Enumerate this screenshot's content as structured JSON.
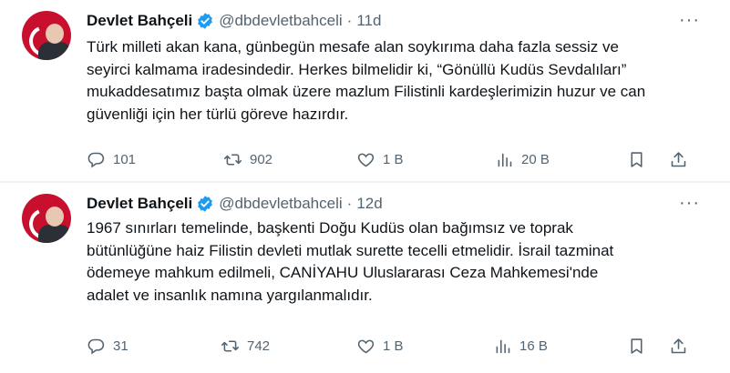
{
  "tweets": [
    {
      "author": "Devlet Bahçeli",
      "handle": "@dbdevletbahceli",
      "separator": "·",
      "time": "11d",
      "more": "···",
      "text": "Türk milleti akan kana, günbegün mesafe alan soykırıma daha fazla sessiz ve seyirci kalmama iradesindedir. Herkes bilmelidir ki, “Gönüllü Kudüs Sevdalıları” mukaddesatımız başta olmak üzere mazlum Filistinli kardeşlerimizin huzur ve can güvenliği için her türlü göreve hazırdır.",
      "stats": {
        "replies": "101",
        "reposts": "902",
        "likes": "1 B",
        "views": "20 B"
      }
    },
    {
      "author": "Devlet Bahçeli",
      "handle": "@dbdevletbahceli",
      "separator": "·",
      "time": "12d",
      "more": "···",
      "text": "1967 sınırları temelinde, başkenti Doğu Kudüs olan bağımsız ve toprak bütünlüğüne haiz Filistin devleti mutlak surette tecelli etmelidir. İsrail tazminat ödemeye mahkum edilmeli, CANİYAHU Uluslararası Ceza Mahkemesi'nde adalet ve insanlık namına yargılanmalıdır.",
      "stats": {
        "replies": "31",
        "reposts": "742",
        "likes": "1 B",
        "views": "16 B"
      }
    }
  ],
  "icons": {
    "reply": "reply-icon",
    "repost": "repost-icon",
    "like": "like-icon",
    "views": "views-icon",
    "bookmark": "bookmark-icon",
    "share": "share-icon",
    "verified": "verified-badge-icon"
  },
  "colors": {
    "verified": "#1d9bf0",
    "muted": "#536471",
    "avatar": "#c8102e"
  }
}
